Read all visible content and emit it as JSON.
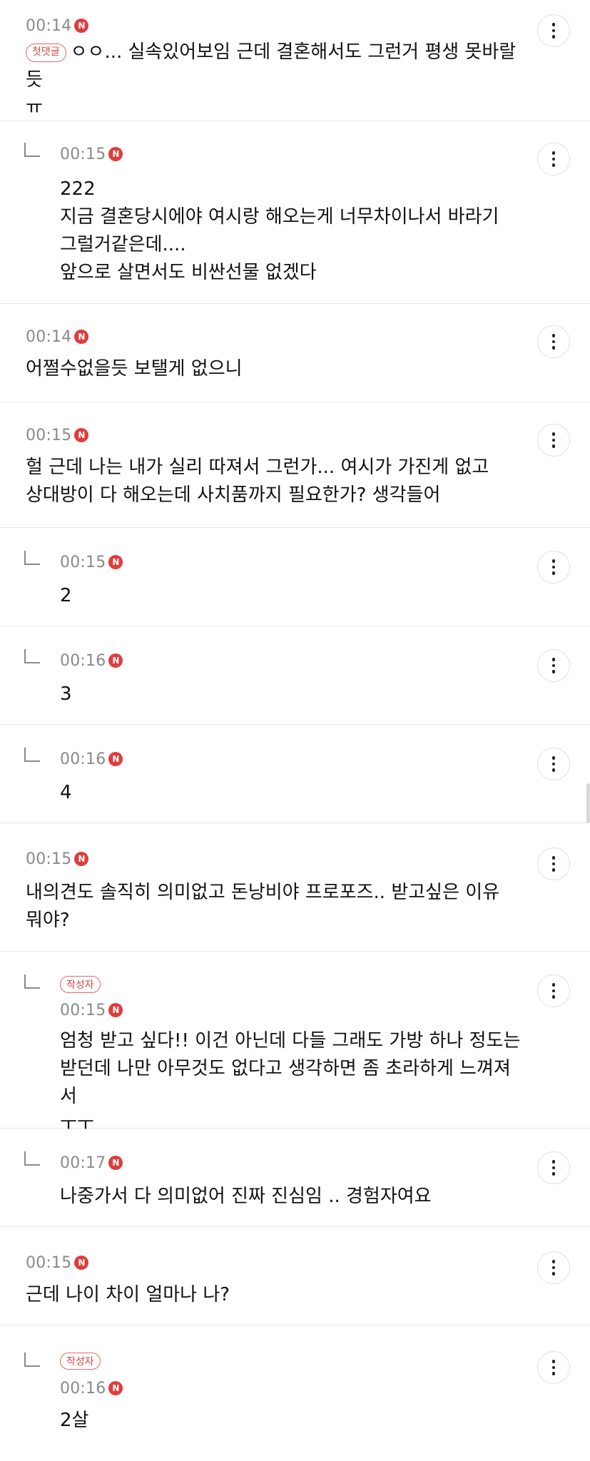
{
  "comments": [
    {
      "type": "top",
      "time": "00:14",
      "first_tag": "첫댓글",
      "lines": [
        "ㅇㅇ... 실속있어보임 근데 결혼해서도 그런거 평생 못바랄듯",
        "ㅠ"
      ]
    },
    {
      "type": "reply",
      "time": "00:15",
      "lines": [
        "222",
        "지금 결혼당시에야 여시랑 해오는게 너무차이나서 바라기",
        "그럴거같은데....",
        "앞으로 살면서도 비싼선물 없겠다"
      ]
    },
    {
      "type": "top",
      "time": "00:14",
      "lines": [
        "어쩔수없을듯 보탤게 없으니"
      ]
    },
    {
      "type": "top",
      "time": "00:15",
      "lines": [
        "헐 근데 나는 내가 실리 따져서 그런가... 여시가 가진게 없고",
        "상대방이 다 해오는데 사치품까지 필요한가? 생각들어"
      ]
    },
    {
      "type": "reply",
      "time": "00:15",
      "lines": [
        "2"
      ]
    },
    {
      "type": "reply",
      "time": "00:16",
      "lines": [
        "3"
      ]
    },
    {
      "type": "reply",
      "time": "00:16",
      "lines": [
        "4"
      ]
    },
    {
      "type": "top",
      "time": "00:15",
      "lines": [
        "내의견도 솔직히 의미없고 돈낭비야 프로포즈.. 받고싶은 이유",
        "뭐야?"
      ]
    },
    {
      "type": "reply",
      "time": "00:15",
      "author_tag": "작성자",
      "lines": [
        "엄청 받고 싶다!! 이건 아닌데 다들 그래도 가방 하나 정도는",
        "받던데 나만 아무것도 없다고 생각하면 좀 초라하게 느껴져서",
        "ㅜㅜ"
      ]
    },
    {
      "type": "reply",
      "time": "00:17",
      "lines": [
        "나중가서 다 의미없어 진짜 진심임 .. 경험자여요"
      ]
    },
    {
      "type": "top",
      "time": "00:15",
      "lines": [
        "근데 나이 차이 얼마나 나?"
      ]
    },
    {
      "type": "reply",
      "time": "00:16",
      "author_tag": "작성자",
      "lines": [
        "2살"
      ]
    }
  ],
  "ui": {
    "new_badge": "N",
    "more_icon": "more-vertical-icon",
    "reply_icon": "reply-arrow-icon",
    "colors": {
      "badge": "#e03c3c",
      "tag_border": "#e06a6a",
      "tag_text": "#d64545",
      "time": "#8a8a8a",
      "divider": "#e8e8e8"
    }
  }
}
